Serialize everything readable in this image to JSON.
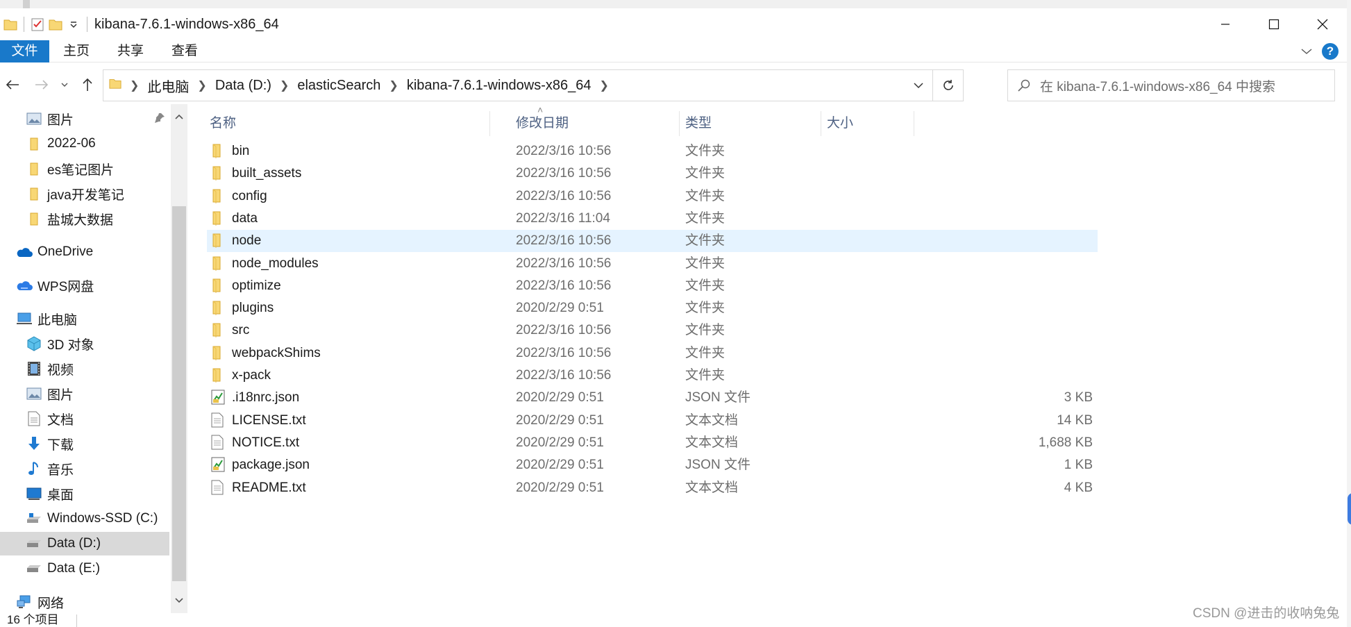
{
  "window": {
    "title": "kibana-7.6.1-windows-x86_64"
  },
  "ribbon": {
    "tabs": [
      "文件",
      "主页",
      "共享",
      "查看"
    ]
  },
  "address": {
    "crumbs": [
      "此电脑",
      "Data (D:)",
      "elasticSearch",
      "kibana-7.6.1-windows-x86_64"
    ]
  },
  "search": {
    "placeholder": "在 kibana-7.6.1-windows-x86_64 中搜索"
  },
  "sidebar": {
    "items": [
      {
        "label": "图片",
        "icon": "pictures-icon",
        "pinned": true
      },
      {
        "label": "2022-06",
        "icon": "folder-icon"
      },
      {
        "label": "es笔记图片",
        "icon": "folder-icon"
      },
      {
        "label": "java开发笔记",
        "icon": "folder-icon"
      },
      {
        "label": "盐城大数据",
        "icon": "folder-icon"
      },
      {
        "label": "OneDrive",
        "icon": "onedrive-cloud-icon"
      },
      {
        "label": "WPS网盘",
        "icon": "wps-cloud-icon"
      },
      {
        "label": "此电脑",
        "icon": "this-pc-icon"
      },
      {
        "label": "3D 对象",
        "icon": "3d-objects-icon"
      },
      {
        "label": "视频",
        "icon": "videos-icon"
      },
      {
        "label": "图片",
        "icon": "pictures-icon"
      },
      {
        "label": "文档",
        "icon": "documents-icon"
      },
      {
        "label": "下载",
        "icon": "downloads-icon"
      },
      {
        "label": "音乐",
        "icon": "music-icon"
      },
      {
        "label": "桌面",
        "icon": "desktop-icon"
      },
      {
        "label": "Windows-SSD (C:)",
        "icon": "system-drive-icon"
      },
      {
        "label": "Data (D:)",
        "icon": "drive-icon",
        "selected": true
      },
      {
        "label": "Data (E:)",
        "icon": "drive-icon"
      },
      {
        "label": "网络",
        "icon": "network-icon"
      }
    ]
  },
  "columns": {
    "name": "名称",
    "date": "修改日期",
    "type": "类型",
    "size": "大小"
  },
  "files": [
    {
      "name": "bin",
      "date": "2022/3/16 10:56",
      "type": "文件夹",
      "size": "",
      "kind": "folder"
    },
    {
      "name": "built_assets",
      "date": "2022/3/16 10:56",
      "type": "文件夹",
      "size": "",
      "kind": "folder"
    },
    {
      "name": "config",
      "date": "2022/3/16 10:56",
      "type": "文件夹",
      "size": "",
      "kind": "folder"
    },
    {
      "name": "data",
      "date": "2022/3/16 11:04",
      "type": "文件夹",
      "size": "",
      "kind": "folder"
    },
    {
      "name": "node",
      "date": "2022/3/16 10:56",
      "type": "文件夹",
      "size": "",
      "kind": "folder",
      "hover": true
    },
    {
      "name": "node_modules",
      "date": "2022/3/16 10:56",
      "type": "文件夹",
      "size": "",
      "kind": "folder"
    },
    {
      "name": "optimize",
      "date": "2022/3/16 10:56",
      "type": "文件夹",
      "size": "",
      "kind": "folder"
    },
    {
      "name": "plugins",
      "date": "2020/2/29 0:51",
      "type": "文件夹",
      "size": "",
      "kind": "folder"
    },
    {
      "name": "src",
      "date": "2022/3/16 10:56",
      "type": "文件夹",
      "size": "",
      "kind": "folder"
    },
    {
      "name": "webpackShims",
      "date": "2022/3/16 10:56",
      "type": "文件夹",
      "size": "",
      "kind": "folder"
    },
    {
      "name": "x-pack",
      "date": "2022/3/16 10:56",
      "type": "文件夹",
      "size": "",
      "kind": "folder"
    },
    {
      "name": ".i18nrc.json",
      "date": "2020/2/29 0:51",
      "type": "JSON 文件",
      "size": "3 KB",
      "kind": "json"
    },
    {
      "name": "LICENSE.txt",
      "date": "2020/2/29 0:51",
      "type": "文本文档",
      "size": "14 KB",
      "kind": "text"
    },
    {
      "name": "NOTICE.txt",
      "date": "2020/2/29 0:51",
      "type": "文本文档",
      "size": "1,688 KB",
      "kind": "text"
    },
    {
      "name": "package.json",
      "date": "2020/2/29 0:51",
      "type": "JSON 文件",
      "size": "1 KB",
      "kind": "json"
    },
    {
      "name": "README.txt",
      "date": "2020/2/29 0:51",
      "type": "文本文档",
      "size": "4 KB",
      "kind": "text"
    }
  ],
  "status": {
    "count": "16 个项目"
  },
  "watermark": "CSDN @进击的收呐兔兔",
  "colors": {
    "accent": "#1979ca",
    "folder": "#f8d775",
    "hover_row": "#e5f3ff",
    "selected_nav": "#d9d9d9"
  }
}
